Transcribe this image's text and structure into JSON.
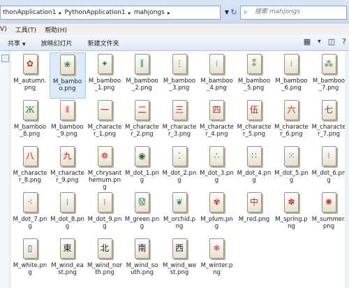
{
  "address": {
    "crumbs": [
      "thonApplication1",
      "PythonApplication1",
      "mahjongs"
    ],
    "separator": "▸"
  },
  "search": {
    "placeholder": "搜索 mahjongs",
    "icon": "search-icon"
  },
  "menu": [
    "V)",
    "工具(T)",
    "帮助(H)"
  ],
  "toolbar": {
    "share": "共享",
    "slideshow": "放映幻灯片",
    "new_folder": "新建文件夹",
    "dropdown_glyph": "▼"
  },
  "files": [
    {
      "name": "M_autumn.png",
      "glyph": "✿",
      "color": "#c0392b",
      "selected": false
    },
    {
      "name": "M_bamboo.png",
      "glyph": "❀",
      "color": "#2e8b57",
      "selected": true
    },
    {
      "name": "M_bamboo_1.png",
      "glyph": "✦",
      "color": "#2e8b57",
      "selected": false
    },
    {
      "name": "M_bamboo_2.png",
      "glyph": "∥",
      "color": "#2e8b57",
      "selected": false
    },
    {
      "name": "M_bamboo_3.png",
      "glyph": "⋮",
      "color": "#2e8b57",
      "selected": false
    },
    {
      "name": "M_bamboo_4.png",
      "glyph": "⁞",
      "color": "#2e8b57",
      "selected": false
    },
    {
      "name": "M_bamboo_5.png",
      "glyph": "⁑",
      "color": "#2e8b57",
      "selected": false
    },
    {
      "name": "M_bamboo_6.png",
      "glyph": "⁞",
      "color": "#2e8b57",
      "selected": false
    },
    {
      "name": "M_bamboo_7.png",
      "glyph": "⁂",
      "color": "#2e8b57",
      "selected": false
    },
    {
      "name": "M_bamboo_8.png",
      "glyph": "Ж",
      "color": "#2e8b57",
      "selected": false
    },
    {
      "name": "M_bamboo_9.png",
      "glyph": "⦀",
      "color": "#c0392b",
      "selected": false
    },
    {
      "name": "M_character_1.png",
      "glyph": "一",
      "color": "#b22222",
      "selected": false
    },
    {
      "name": "M_character_2.png",
      "glyph": "二",
      "color": "#b22222",
      "selected": false
    },
    {
      "name": "M_character_3.png",
      "glyph": "三",
      "color": "#b22222",
      "selected": false
    },
    {
      "name": "M_character_4.png",
      "glyph": "四",
      "color": "#b22222",
      "selected": false
    },
    {
      "name": "M_character_5.png",
      "glyph": "伍",
      "color": "#b22222",
      "selected": false
    },
    {
      "name": "M_character_6.png",
      "glyph": "六",
      "color": "#b22222",
      "selected": false
    },
    {
      "name": "M_character_7.png",
      "glyph": "七",
      "color": "#b22222",
      "selected": false
    },
    {
      "name": "M_character_8.png",
      "glyph": "八",
      "color": "#b22222",
      "selected": false
    },
    {
      "name": "M_character_9.png",
      "glyph": "九",
      "color": "#b22222",
      "selected": false
    },
    {
      "name": "M_chrysanthemum.png",
      "glyph": "❁",
      "color": "#c0392b",
      "selected": false
    },
    {
      "name": "M_dot_1.png",
      "glyph": "◉",
      "color": "#2e6b3a",
      "selected": false
    },
    {
      "name": "M_dot_2.png",
      "glyph": "⁚",
      "color": "#2e6b3a",
      "selected": false
    },
    {
      "name": "M_dot_3.png",
      "glyph": "∴",
      "color": "#2e6b3a",
      "selected": false
    },
    {
      "name": "M_dot_4.png",
      "glyph": "∷",
      "color": "#2e6b3a",
      "selected": false
    },
    {
      "name": "M_dot_5.png",
      "glyph": "⁙",
      "color": "#2e6b3a",
      "selected": false
    },
    {
      "name": "M_dot_6.png",
      "glyph": "⁝",
      "color": "#b22222",
      "selected": false
    },
    {
      "name": "M_dot_7.png",
      "glyph": "⁖",
      "color": "#b22222",
      "selected": false
    },
    {
      "name": "M_dot_8.png",
      "glyph": "⁞",
      "color": "#2b4f8a",
      "selected": false
    },
    {
      "name": "M_dot_9.png",
      "glyph": "⁞",
      "color": "#b22222",
      "selected": false
    },
    {
      "name": "M_green.png",
      "glyph": "發",
      "color": "#2e8b57",
      "selected": false
    },
    {
      "name": "M_orchid.png",
      "glyph": "❦",
      "color": "#2e8b57",
      "selected": false
    },
    {
      "name": "M_plum.png",
      "glyph": "✾",
      "color": "#c0392b",
      "selected": false
    },
    {
      "name": "M_red.png",
      "glyph": "中",
      "color": "#d21f1f",
      "selected": false
    },
    {
      "name": "M_spring.png",
      "glyph": "✽",
      "color": "#c0392b",
      "selected": false
    },
    {
      "name": "M_summer.png",
      "glyph": "✺",
      "color": "#c0392b",
      "selected": false
    },
    {
      "name": "M_white.png",
      "glyph": "▯",
      "color": "#2b4f8a",
      "selected": false
    },
    {
      "name": "M_wind_east.png",
      "glyph": "東",
      "color": "#222222",
      "selected": false
    },
    {
      "name": "M_wind_north.png",
      "glyph": "北",
      "color": "#222222",
      "selected": false
    },
    {
      "name": "M_wind_south.png",
      "glyph": "南",
      "color": "#222222",
      "selected": false
    },
    {
      "name": "M_wind_west.png",
      "glyph": "西",
      "color": "#222222",
      "selected": false
    },
    {
      "name": "M_winter.png",
      "glyph": "❄",
      "color": "#c0392b",
      "selected": false
    }
  ]
}
